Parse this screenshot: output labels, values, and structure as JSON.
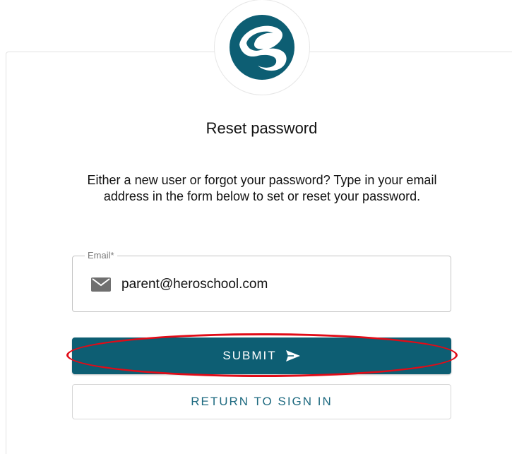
{
  "page": {
    "title": "Reset password",
    "intro": "Either a new user or forgot your password? Type in your email address in the form below to set or reset your password."
  },
  "email": {
    "label": "Email*",
    "value": "parent@heroschool.com",
    "icon": "mail-icon"
  },
  "actions": {
    "submit_label": "SUBMIT",
    "submit_icon": "send-icon",
    "return_label": "RETURN TO SIGN IN"
  },
  "colors": {
    "brand": "#0d5e73",
    "highlight": "#e10b17",
    "link": "#1e6a80"
  }
}
